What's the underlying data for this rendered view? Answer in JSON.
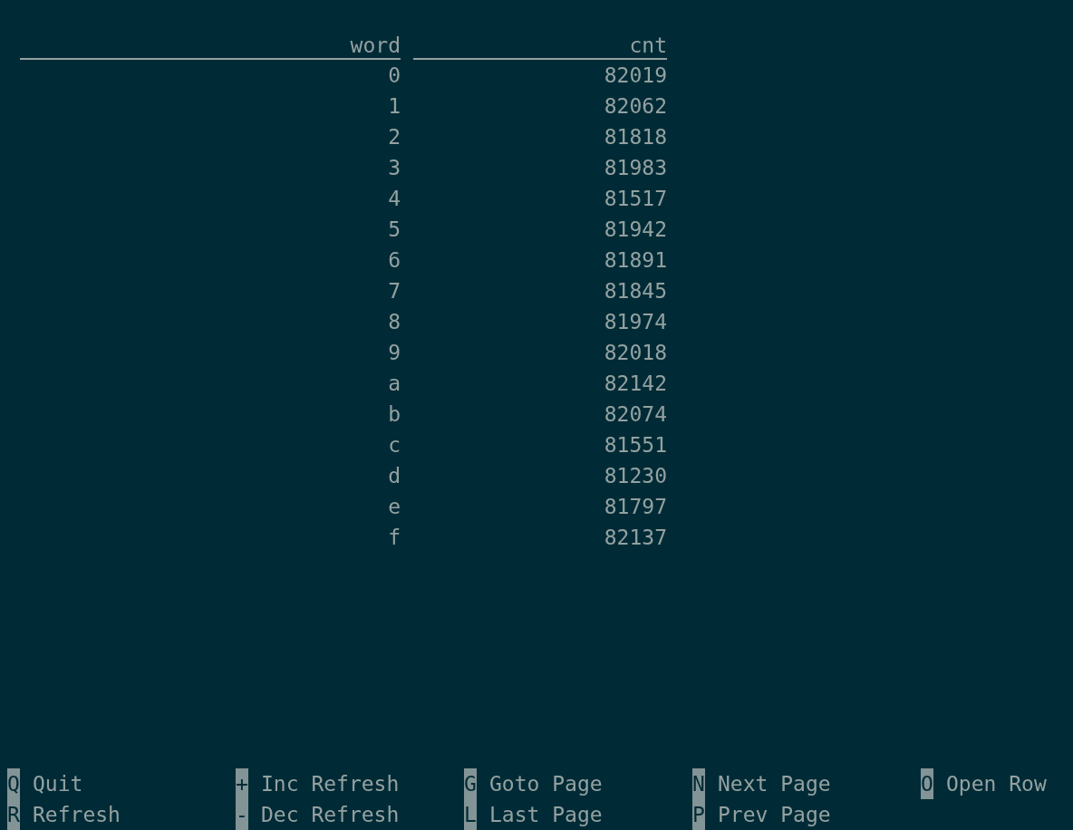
{
  "table": {
    "columns": [
      "word",
      "cnt"
    ],
    "rows": [
      [
        "0",
        "82019"
      ],
      [
        "1",
        "82062"
      ],
      [
        "2",
        "81818"
      ],
      [
        "3",
        "81983"
      ],
      [
        "4",
        "81517"
      ],
      [
        "5",
        "81942"
      ],
      [
        "6",
        "81891"
      ],
      [
        "7",
        "81845"
      ],
      [
        "8",
        "81974"
      ],
      [
        "9",
        "82018"
      ],
      [
        "a",
        "82142"
      ],
      [
        "b",
        "82074"
      ],
      [
        "c",
        "81551"
      ],
      [
        "d",
        "81230"
      ],
      [
        "e",
        "81797"
      ],
      [
        "f",
        "82137"
      ]
    ]
  },
  "key_bar": [
    [
      {
        "key": "Q",
        "label": "Quit"
      },
      {
        "key": "+",
        "label": "Inc Refresh"
      },
      {
        "key": "G",
        "label": "Goto Page"
      },
      {
        "key": "N",
        "label": "Next Page"
      },
      {
        "key": "O",
        "label": "Open Row"
      }
    ],
    [
      {
        "key": "R",
        "label": "Refresh"
      },
      {
        "key": "-",
        "label": "Dec Refresh"
      },
      {
        "key": "L",
        "label": "Last Page"
      },
      {
        "key": "P",
        "label": "Prev Page"
      }
    ]
  ]
}
